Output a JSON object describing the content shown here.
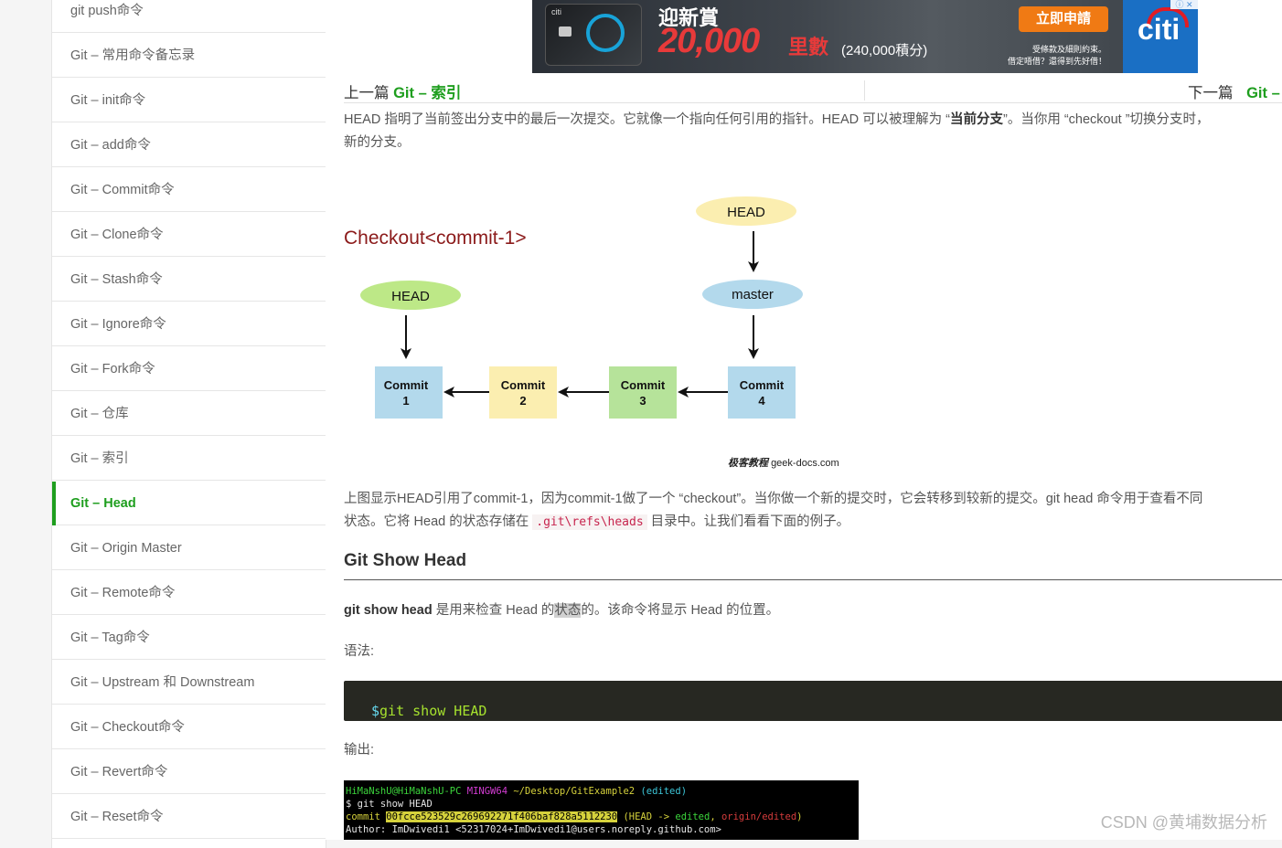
{
  "sidebar": {
    "items": [
      {
        "label": "git push命令",
        "active": false
      },
      {
        "label": "Git – 常用命令备忘录",
        "active": false
      },
      {
        "label": "Git – init命令",
        "active": false
      },
      {
        "label": "Git – add命令",
        "active": false
      },
      {
        "label": "Git – Commit命令",
        "active": false
      },
      {
        "label": "Git – Clone命令",
        "active": false
      },
      {
        "label": "Git – Stash命令",
        "active": false
      },
      {
        "label": "Git – Ignore命令",
        "active": false
      },
      {
        "label": "Git – Fork命令",
        "active": false
      },
      {
        "label": "Git – 仓库",
        "active": false
      },
      {
        "label": "Git – 索引",
        "active": false
      },
      {
        "label": "Git – Head",
        "active": true
      },
      {
        "label": "Git – Origin Master",
        "active": false
      },
      {
        "label": "Git – Remote命令",
        "active": false
      },
      {
        "label": "Git – Tag命令",
        "active": false
      },
      {
        "label": "Git – Upstream 和 Downstream",
        "active": false
      },
      {
        "label": "Git – Checkout命令",
        "active": false
      },
      {
        "label": "Git – Revert命令",
        "active": false
      },
      {
        "label": "Git – Reset命令",
        "active": false
      }
    ],
    "accent_color": "#1e9e1e"
  },
  "ad": {
    "card_brand": "citi",
    "title": "迎新賞",
    "amount": "20,000",
    "unit": "里數",
    "points": "(240,000積分)",
    "apply_label": "立即申請",
    "fine_print_1": "受條款及細則約束。",
    "fine_print_2": "借定唔借？還得到先好借！",
    "brand": "citi"
  },
  "nav": {
    "prev_prefix": "上一篇",
    "prev_title": "Git – 索引",
    "next_prefix": "下一篇",
    "next_title": "Git –"
  },
  "article": {
    "intro_line1_a": "HEAD 指明了当前签出分支中的最后一次提交。它就像一个指向任何引用的指针。HEAD 可以被理解为 “",
    "intro_line1_bold": "当前分支",
    "intro_line1_b": "”。当你用 “checkout ”切换分支时，",
    "intro_line2": "新的分支。",
    "desc_line1": "上图显示HEAD引用了commit-1，因为commit-1做了一个 “checkout”。当你做一个新的提交时，它会转移到较新的提交。git head 命令用于查看不同",
    "desc_line2_a": "状态。它将 Head 的状态存储在 ",
    "desc_line2_code": ".git\\refs\\heads",
    "desc_line2_b": " 目录中。让我们看看下面的例子。",
    "section_heading": "Git Show Head",
    "show_bold": "git show head",
    "show_a": " 是用来检查 Head 的",
    "show_hl": "状态",
    "show_b": "的。该命令将显示 Head 的位置。",
    "syntax_label": "语法:",
    "code_prompt": "$",
    "code_cmd": " git show HEAD",
    "output_label": "输出:"
  },
  "diagram": {
    "title": "Checkout<commit-1>",
    "head_left": "HEAD",
    "head_right": "HEAD",
    "master": "master",
    "commits": [
      {
        "line1": "Commit",
        "line2": "1",
        "color": "#b3d9ec"
      },
      {
        "line1": "Commit",
        "line2": "2",
        "color": "#fbeeb0"
      },
      {
        "line1": "Commit",
        "line2": "3",
        "color": "#b6e39a"
      },
      {
        "line1": "Commit",
        "line2": "4",
        "color": "#b3d9ec"
      }
    ],
    "watermark_cn": "极客教程",
    "watermark_url": "geek-docs.com"
  },
  "terminal": {
    "user": "HiMaNshU@HiMaNshU-PC",
    "env": "MINGW64",
    "path": "~/Desktop/GitExample2",
    "branch_state": "(edited)",
    "command": "$ git show HEAD",
    "commit_label": "commit",
    "commit_hash": "00fcce523529c269692271f406baf828a5112230",
    "refs_open": "(HEAD -> ",
    "ref_local": "edited",
    "ref_sep": ", ",
    "ref_remote": "origin/edited",
    "refs_close": ")",
    "author_line": "Author: ImDwivedi1 <52317024+ImDwivedi1@users.noreply.github.com>"
  },
  "watermark": "CSDN @黄埔数据分析"
}
